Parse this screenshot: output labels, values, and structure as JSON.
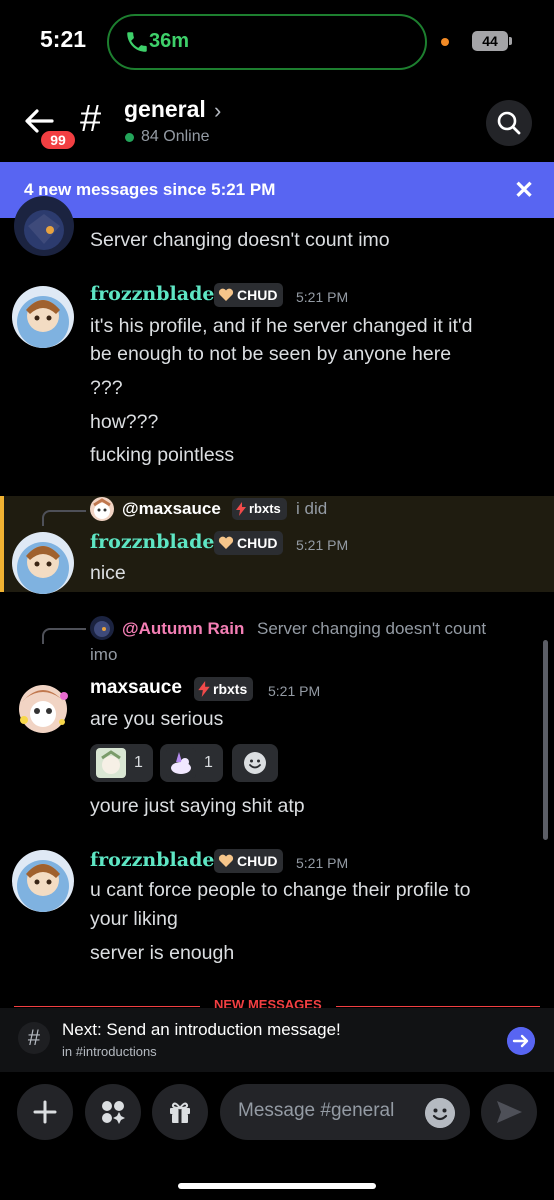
{
  "status_bar": {
    "time": "5:21",
    "call_duration": "36m",
    "battery": "44"
  },
  "header": {
    "back_badge": "99",
    "hash": "#",
    "channel_name": "general",
    "chevron": "›",
    "online": "84 Online"
  },
  "new_messages_bar": {
    "text": "4 new messages since 5:21 PM",
    "close": "✕"
  },
  "messages": [
    {
      "continued_text": "Server changing doesn't count imo"
    },
    {
      "author": "frozznblade",
      "tag": "CHUD",
      "tag_icon": "heart-icon",
      "time": "5:21 PM",
      "lines": [
        "it's his profile, and if he server changed it it'd",
        "be enough to not be seen by anyone here",
        "???",
        "how???",
        "fucking pointless"
      ]
    },
    {
      "reply_to": {
        "name": "@maxsauce",
        "tag": "rbxts",
        "text": "i did"
      },
      "author": "frozznblade",
      "tag": "CHUD",
      "time": "5:21 PM",
      "lines": [
        "nice"
      ]
    },
    {
      "reply_to": {
        "name": "@Autumn Rain",
        "text_line1": "Server changing doesn't count",
        "text_line2": "imo"
      },
      "author": "maxsauce",
      "tag": "rbxts",
      "tag_icon": "lightning-icon",
      "time": "5:21 PM",
      "lines": [
        "are you serious",
        "youre just saying shit atp"
      ],
      "reactions": [
        {
          "count": "1"
        },
        {
          "count": "1"
        }
      ]
    },
    {
      "author": "frozznblade",
      "tag": "CHUD",
      "time": "5:21 PM",
      "lines": [
        "u cant force people to change their profile to",
        "your liking",
        "server is enough"
      ]
    }
  ],
  "divider": {
    "text": "NEW MESSAGES"
  },
  "next_card": {
    "hash": "#",
    "title": "Next: Send an introduction message!",
    "subtitle": "in #introductions"
  },
  "composer": {
    "placeholder": "Message #general"
  },
  "colors": {
    "accent": "#5865f2",
    "frozznblade_name": "#5ee6c4",
    "autumn_rain": "#f47fb5",
    "mention_reply": "#ffffff",
    "highlight_bar": "#f0b232",
    "new_divider": "#f23f42",
    "online": "#23a55a"
  }
}
